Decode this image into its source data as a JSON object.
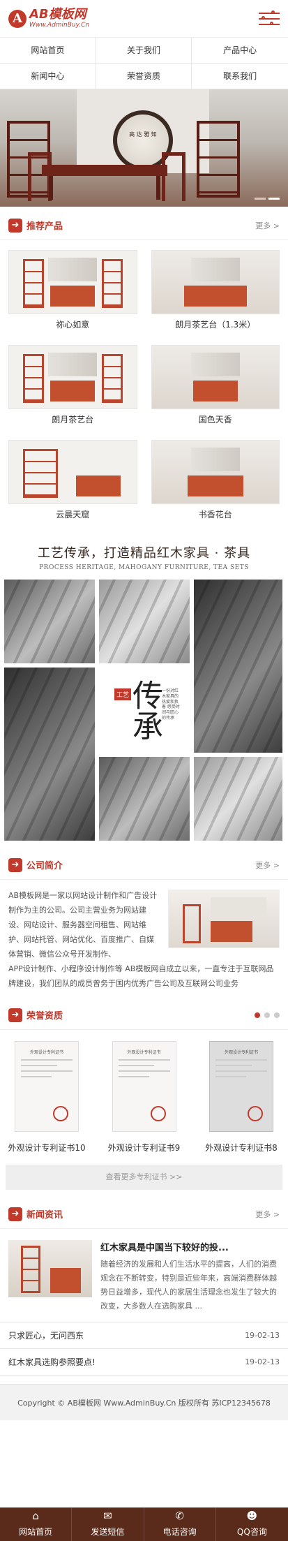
{
  "header": {
    "logo_mark": "A",
    "logo_title": "AB模板网",
    "logo_sub": "Www.AdminBuy.Cn"
  },
  "nav": [
    {
      "label": "网站首页"
    },
    {
      "label": "关于我们"
    },
    {
      "label": "产品中心"
    },
    {
      "label": "新闻中心"
    },
    {
      "label": "荣誉资质"
    },
    {
      "label": "联系我们"
    }
  ],
  "banner": {
    "moon_text": "高 达 雅 知"
  },
  "products_section": {
    "title": "推荐产品",
    "more": "更多 >",
    "items": [
      {
        "name": "祢心如意"
      },
      {
        "name": "朗月茶艺台（1.3米）"
      },
      {
        "name": "朗月茶艺台"
      },
      {
        "name": "国色天香"
      },
      {
        "name": "云晨天窟"
      },
      {
        "name": "书香花台"
      }
    ]
  },
  "craft": {
    "title_cn": "工艺传承，打造精品红木家具 · 茶具",
    "title_en": "PROCESS HERITAGE, MAHOGANY FURNITURE, TEA SETS",
    "chuan_char": "传承",
    "chuan_tag": "工艺",
    "chuan_vert": "一份对红木家具的热爱和执着 感受时间与匠心的传承"
  },
  "intro_section": {
    "title": "公司简介",
    "more": "更多 >",
    "text_top": "AB模板网是一家以网站设计制作和广告设计制作为主的公司。公司主营业务为网站建设、网站设计、服务器空间租售、网站维护、网站托管、网站优化、百度推广、自媒体营销、微信公众号开发制作、",
    "text_bottom": "APP设计制作、小程序设计制作等 AB模板网自成立以来，一直专注于互联网品牌建设，我们团队的成员曾务于国内优秀广告公司及互联网公司业务"
  },
  "honors_section": {
    "title": "荣誉资质",
    "certs": [
      {
        "name": "外观设计专利证书10",
        "header": "外观设计专利证书"
      },
      {
        "name": "外观设计专利证书9",
        "header": "外观设计专利证书"
      },
      {
        "name": "外观设计专利证书8",
        "header": "外观设计专利证书"
      }
    ],
    "more_label": "查看更多专利证书 >>"
  },
  "news_section": {
    "title": "新闻资讯",
    "more": "更多 >",
    "top": {
      "title": "红木家具是中国当下较好的投...",
      "summary": "随着经济的发展和人们生活水平的提高，人们的消费观念在不断转变，特别是近些年来，高端消费群体越势日益增多，现代人的家居生活理念也发生了较大的改变，大多数人在选购家具 ..."
    },
    "rows": [
      {
        "title": "只求匠心，无问西东",
        "date": "19-02-13"
      },
      {
        "title": "红木家具选购参照要点!",
        "date": "19-02-13"
      }
    ]
  },
  "footer": {
    "copyright": "Copyright © AB模板网 Www.AdminBuy.Cn 版权所有   苏ICP12345678"
  },
  "tabbar": [
    {
      "label": "网站首页",
      "icon": "home-icon",
      "glyph": "⌂"
    },
    {
      "label": "发送短信",
      "icon": "message-icon",
      "glyph": "✉"
    },
    {
      "label": "电话咨询",
      "icon": "phone-icon",
      "glyph": "✆"
    },
    {
      "label": "QQ咨询",
      "icon": "qq-icon",
      "glyph": "☻"
    }
  ],
  "colors": {
    "accent": "#c0392b",
    "tabbar_bg": "#5a2a1a"
  }
}
